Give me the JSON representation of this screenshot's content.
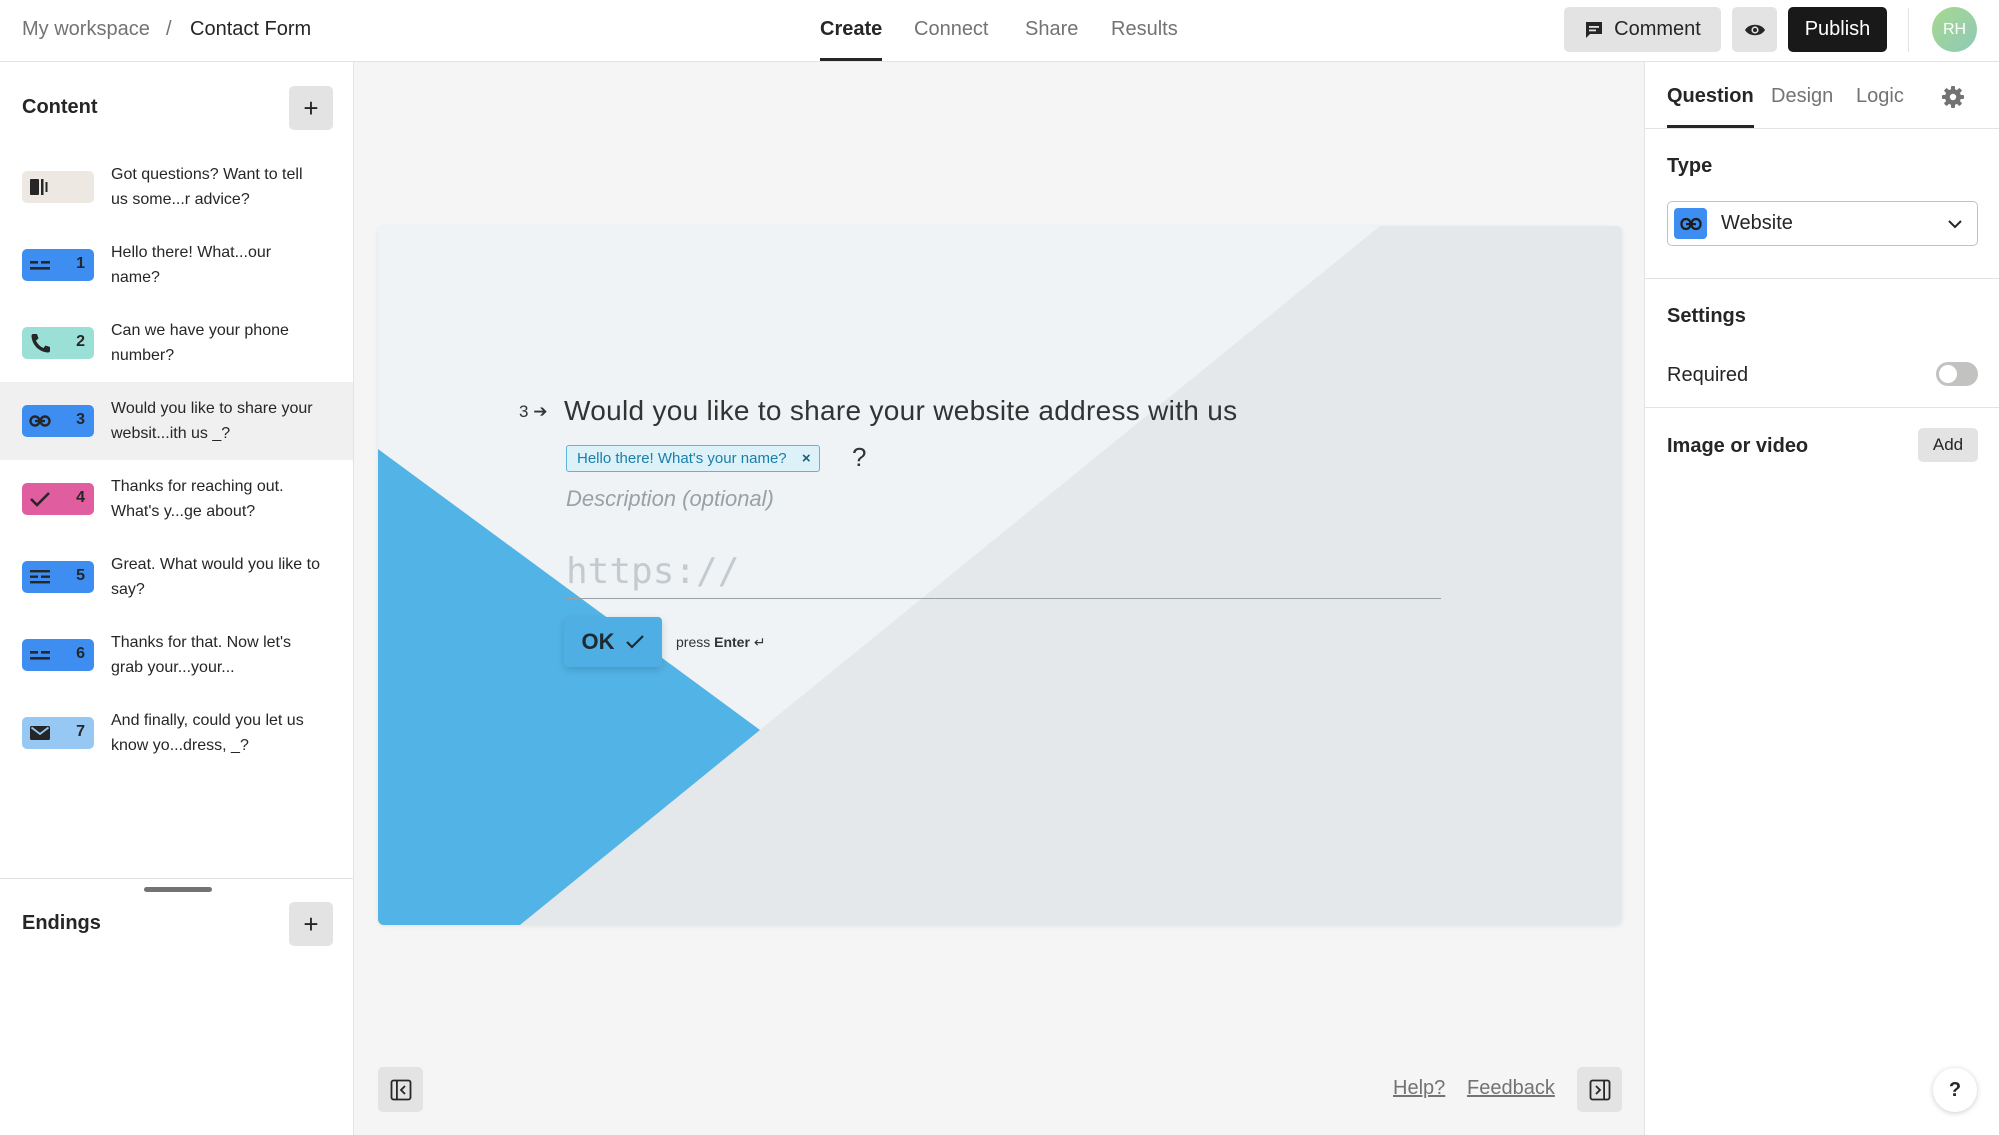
{
  "breadcrumb": {
    "workspace": "My workspace",
    "separator": "/",
    "form": "Contact Form"
  },
  "nav_tabs": {
    "create": "Create",
    "connect": "Connect",
    "share": "Share",
    "results": "Results"
  },
  "toolbar": {
    "comment_label": "Comment",
    "publish_label": "Publish",
    "preview_icon": "eye-icon"
  },
  "user": {
    "initials": "RH"
  },
  "sidebar": {
    "content_heading": "Content",
    "add_symbol": "+",
    "items": [
      {
        "number": "",
        "text": "Got questions? Want to tell us some...r advice?",
        "color": "#ede8e1",
        "icon": "welcome-screen-icon"
      },
      {
        "number": "1",
        "text": "Hello there! What...our name?",
        "color": "#3d8ef0",
        "icon": "short-text-icon"
      },
      {
        "number": "2",
        "text": "Can we have your phone number?",
        "color": "#9be0d7",
        "icon": "phone-icon"
      },
      {
        "number": "3",
        "text": "Would you like to share your websit...ith us _?",
        "color": "#3d8ef0",
        "icon": "link-icon"
      },
      {
        "number": "4",
        "text": "Thanks for reaching out. What's y...ge about?",
        "color": "#e05da0",
        "icon": "check-icon"
      },
      {
        "number": "5",
        "text": "Great. What would you like to say?",
        "color": "#3d8ef0",
        "icon": "long-text-icon"
      },
      {
        "number": "6",
        "text": "Thanks for that. Now let's grab your...your...",
        "color": "#3d8ef0",
        "icon": "short-text-icon"
      },
      {
        "number": "7",
        "text": "And finally, could you let us know yo...dress, _?",
        "color": "#96c8f3",
        "icon": "email-icon"
      }
    ],
    "endings_heading": "Endings"
  },
  "form": {
    "question_number": "3",
    "question_title": "Would you like to share your website address with us",
    "recall_chip": "Hello there! What's your name?",
    "recall_remove": "×",
    "question_mark": "?",
    "description_placeholder": "Description (optional)",
    "answer_placeholder": "https://",
    "ok_label": "OK",
    "press_hint_prefix": "press",
    "press_hint_key": "Enter",
    "press_hint_symbol": "↵",
    "colors": {
      "accent": "#4faee3",
      "background": "#eff3f5",
      "shape": "#e4e8ea"
    }
  },
  "footer": {
    "help": "Help?",
    "feedback": "Feedback"
  },
  "right_panel": {
    "tabs": {
      "question": "Question",
      "design": "Design",
      "logic": "Logic"
    },
    "type_label": "Type",
    "type_value": "Website",
    "settings_label": "Settings",
    "required_label": "Required",
    "required_on": false,
    "media_label": "Image or video",
    "media_add": "Add",
    "help_fab": "?"
  }
}
